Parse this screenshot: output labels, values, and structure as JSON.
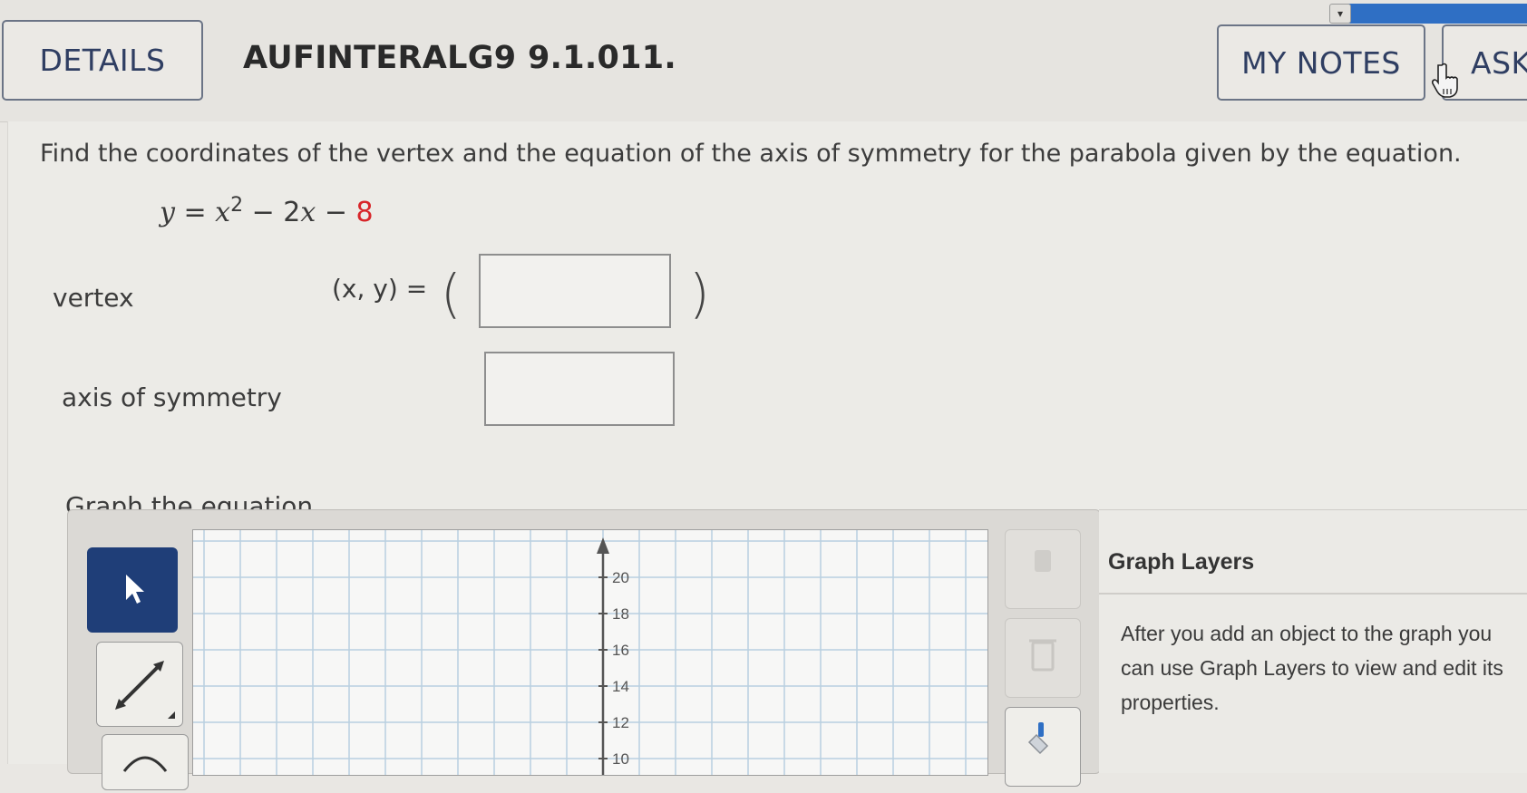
{
  "header": {
    "details_label": "DETAILS",
    "question_id": "AUFINTERALG9 9.1.011.",
    "my_notes_label": "MY NOTES",
    "ask_label": "ASK"
  },
  "question": {
    "prompt": "Find the coordinates of the vertex and the equation of the axis of symmetry for the parabola given by the equation.",
    "equation": {
      "y": "y",
      "equals": " = ",
      "x": "x",
      "exponent": "2",
      "middle": " − 2",
      "x2": "x",
      "minus": " − ",
      "constant": "8"
    },
    "vertex_label": "vertex",
    "vertex_prefix": "(x, y) =",
    "vertex_value": "",
    "axis_label": "axis of symmetry",
    "axis_value": ""
  },
  "graph": {
    "title": "Graph the equation.",
    "y_tick_labels": [
      "20",
      "18",
      "16",
      "14",
      "12",
      "10"
    ],
    "tools": [
      "pointer-tool",
      "line-tool",
      "circle-tool"
    ],
    "side_buttons": [
      "no-solution",
      "delete",
      "fill"
    ]
  },
  "layers": {
    "title": "Graph Layers",
    "line1": "After you add an object to the graph you",
    "line2": "can use Graph Layers to view and edit its",
    "line3": "properties."
  },
  "colors": {
    "accent_blue": "#1f3e78",
    "highlight_red": "#d8262a",
    "button_border": "#6b7486",
    "grid_line": "#b9cfe0"
  }
}
